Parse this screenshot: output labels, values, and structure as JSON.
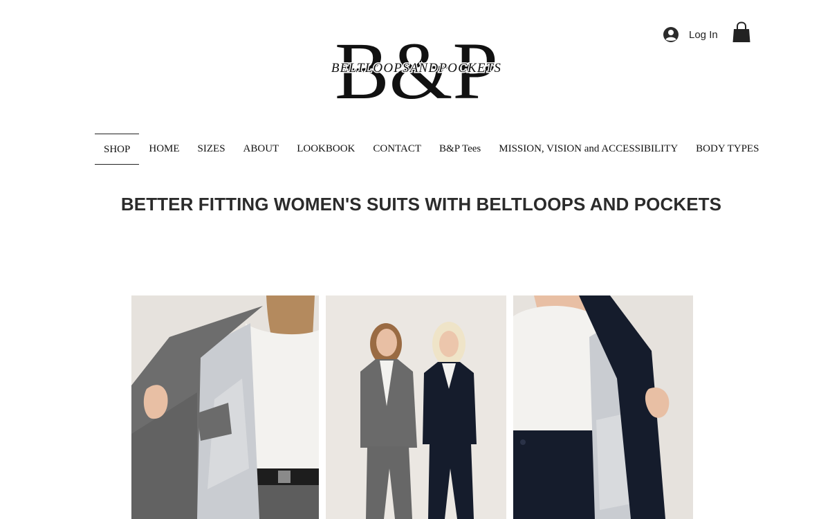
{
  "header": {
    "logo_monogram": "B&P",
    "logo_wordmark": "BELTLOOPSANDPOCKETS",
    "login_label": "Log In",
    "login_icon": "user-circle-icon",
    "cart_icon": "shopping-bag-icon"
  },
  "nav": {
    "items": [
      {
        "label": "SHOP",
        "active": true
      },
      {
        "label": "HOME"
      },
      {
        "label": "SIZES"
      },
      {
        "label": "ABOUT"
      },
      {
        "label": "LOOKBOOK"
      },
      {
        "label": "CONTACT"
      },
      {
        "label": "B&P Tees"
      },
      {
        "label": "MISSION, VISION and ACCESSIBILITY"
      },
      {
        "label": "BODY TYPES"
      }
    ]
  },
  "main": {
    "headline": "BETTER FITTING WOMEN'S SUITS WITH BELTLOOPS AND POCKETS"
  },
  "colors": {
    "text": "#222222",
    "background": "#ffffff",
    "gray_suit": "#6b6b6b",
    "navy_suit": "#151c2c",
    "lining": "#c9ccd1"
  }
}
